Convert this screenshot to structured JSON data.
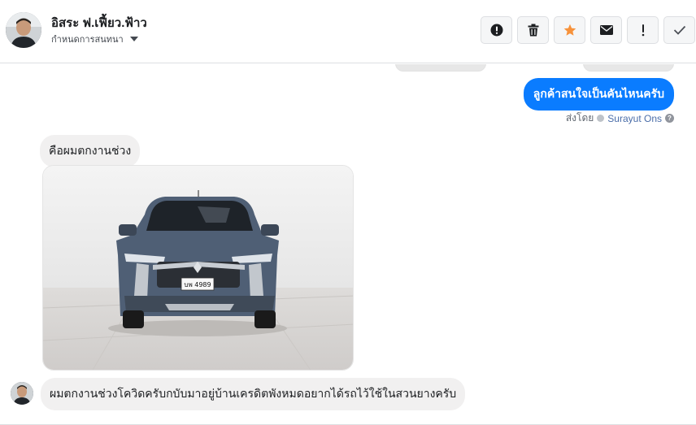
{
  "header": {
    "title": "อิสระ ฟ.เฟี้ยว.ฟ้าว",
    "subtitle": "กำหนดการสนทนา",
    "actions": [
      {
        "name": "report-icon",
        "label": ""
      },
      {
        "name": "trash-icon",
        "label": ""
      },
      {
        "name": "star-icon",
        "label": ""
      },
      {
        "name": "envelope-icon",
        "label": ""
      },
      {
        "name": "exclamation-icon",
        "label": ""
      },
      {
        "name": "check-icon",
        "label": ""
      }
    ]
  },
  "messages": {
    "outgoing_1": "ลูกค้าสนใจเป็นคันไหนครับ",
    "sent_by_prefix": "ส่งโดย",
    "sent_by_name": "Surayut Ons",
    "incoming_1": "คือผมตกงานช่วง",
    "incoming_2": "ผมตกงานช่วงโควิดครับกบับมาอยู่บ้านเครดิตพังหมดอยากได้รถไว้ใช้ในสวนยางครับ",
    "photo_plate": "บพ 4989"
  },
  "colors": {
    "accent": "#0a7cff",
    "star": "#f7923b",
    "incoming_bubble": "#f1f0f0"
  }
}
